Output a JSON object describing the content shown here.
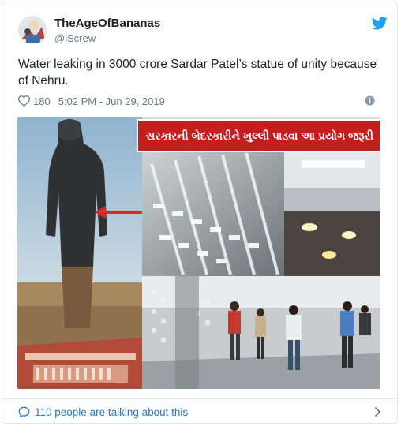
{
  "author": {
    "name": "TheAgeOfBananas",
    "handle": "@iScrew",
    "avatar_icon": "avatar-cartoon"
  },
  "tweet": {
    "text": "Water leaking in 3000 crore Sardar Patel’s statue of unity because of Nehru.",
    "likes": "180",
    "timestamp": "5:02 PM - Jun 29, 2019"
  },
  "media": {
    "banner_text": "સરકારની બેદરકારીને ખુલ્લી પાડવા આ પ્રયોગ જરૂરી",
    "banner_color": "#c41e1e"
  },
  "footer": {
    "talking_text": "110 people are talking about this"
  },
  "colors": {
    "twitter_blue": "#1da1f2",
    "link_blue": "#2b7bb9",
    "meta_gray": "#697882"
  }
}
